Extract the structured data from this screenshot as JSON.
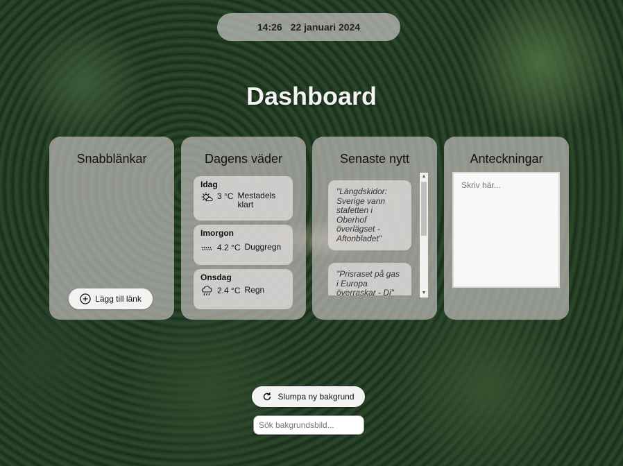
{
  "header": {
    "time": "14:26",
    "date": "22 januari 2024",
    "title": "Dashboard"
  },
  "quicklinks": {
    "heading": "Snabblänkar",
    "add_label": "Lägg till länk",
    "icon": "plus-circle-icon"
  },
  "weather": {
    "heading": "Dagens väder",
    "days": [
      {
        "day": "Idag",
        "temp": "3 °C",
        "desc": "Mestadels klart",
        "icon": "partly-sunny-icon"
      },
      {
        "day": "Imorgon",
        "temp": "4.2 °C",
        "desc": "Duggregn",
        "icon": "drizzle-icon"
      },
      {
        "day": "Onsdag",
        "temp": "2.4 °C",
        "desc": "Regn",
        "icon": "rain-cloud-icon"
      }
    ]
  },
  "news": {
    "heading": "Senaste nytt",
    "items": [
      "\"Längdskidor: Sverige vann stafetten i Oberhof överlägset - Aftonbladet\"",
      "\"Prisraset på gas i Europa överraskar - Di\""
    ]
  },
  "notes": {
    "heading": "Anteckningar",
    "placeholder": "Skriv här..."
  },
  "background": {
    "shuffle_label": "Slumpa ny bakgrund",
    "shuffle_icon": "refresh-icon",
    "search_placeholder": "Sök bakgrundsbild..."
  }
}
